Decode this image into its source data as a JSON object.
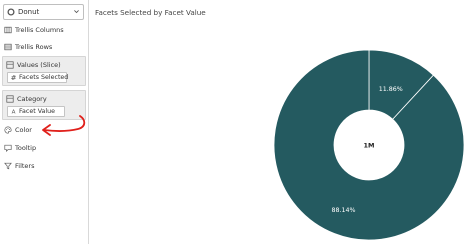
{
  "sidebar": {
    "chart_type": {
      "label": "Donut",
      "icon": "donut-chart-icon"
    },
    "rows": [
      {
        "label": "Trellis Columns",
        "icon": "trellis-columns-icon"
      },
      {
        "label": "Trellis Rows",
        "icon": "trellis-rows-icon"
      }
    ],
    "values_well": {
      "label": "Values (Slice)",
      "icon": "values-slice-icon",
      "pill": {
        "label": "Facets Selected",
        "icon": "measure-hash-icon"
      }
    },
    "category_well": {
      "label": "Category",
      "icon": "category-icon",
      "pill": {
        "label": "Facet Value",
        "icon": "attribute-icon"
      }
    },
    "color": {
      "label": "Color",
      "icon": "palette-icon"
    },
    "tooltip": {
      "label": "Tooltip",
      "icon": "tooltip-icon"
    },
    "filters": {
      "label": "Filters",
      "icon": "filter-funnel-icon"
    }
  },
  "canvas": {
    "title": "Facets Selected by Facet Value"
  },
  "colors": {
    "donut": "#245a60",
    "annotation_arrow": "#e0201b"
  },
  "chart_data": {
    "type": "pie",
    "title": "Facets Selected by Facet Value",
    "center_label": "1M",
    "slices": [
      {
        "label": "11.86%",
        "value": 11.86,
        "color": "#245a60"
      },
      {
        "label": "88.14%",
        "value": 88.14,
        "color": "#245a60"
      }
    ]
  }
}
